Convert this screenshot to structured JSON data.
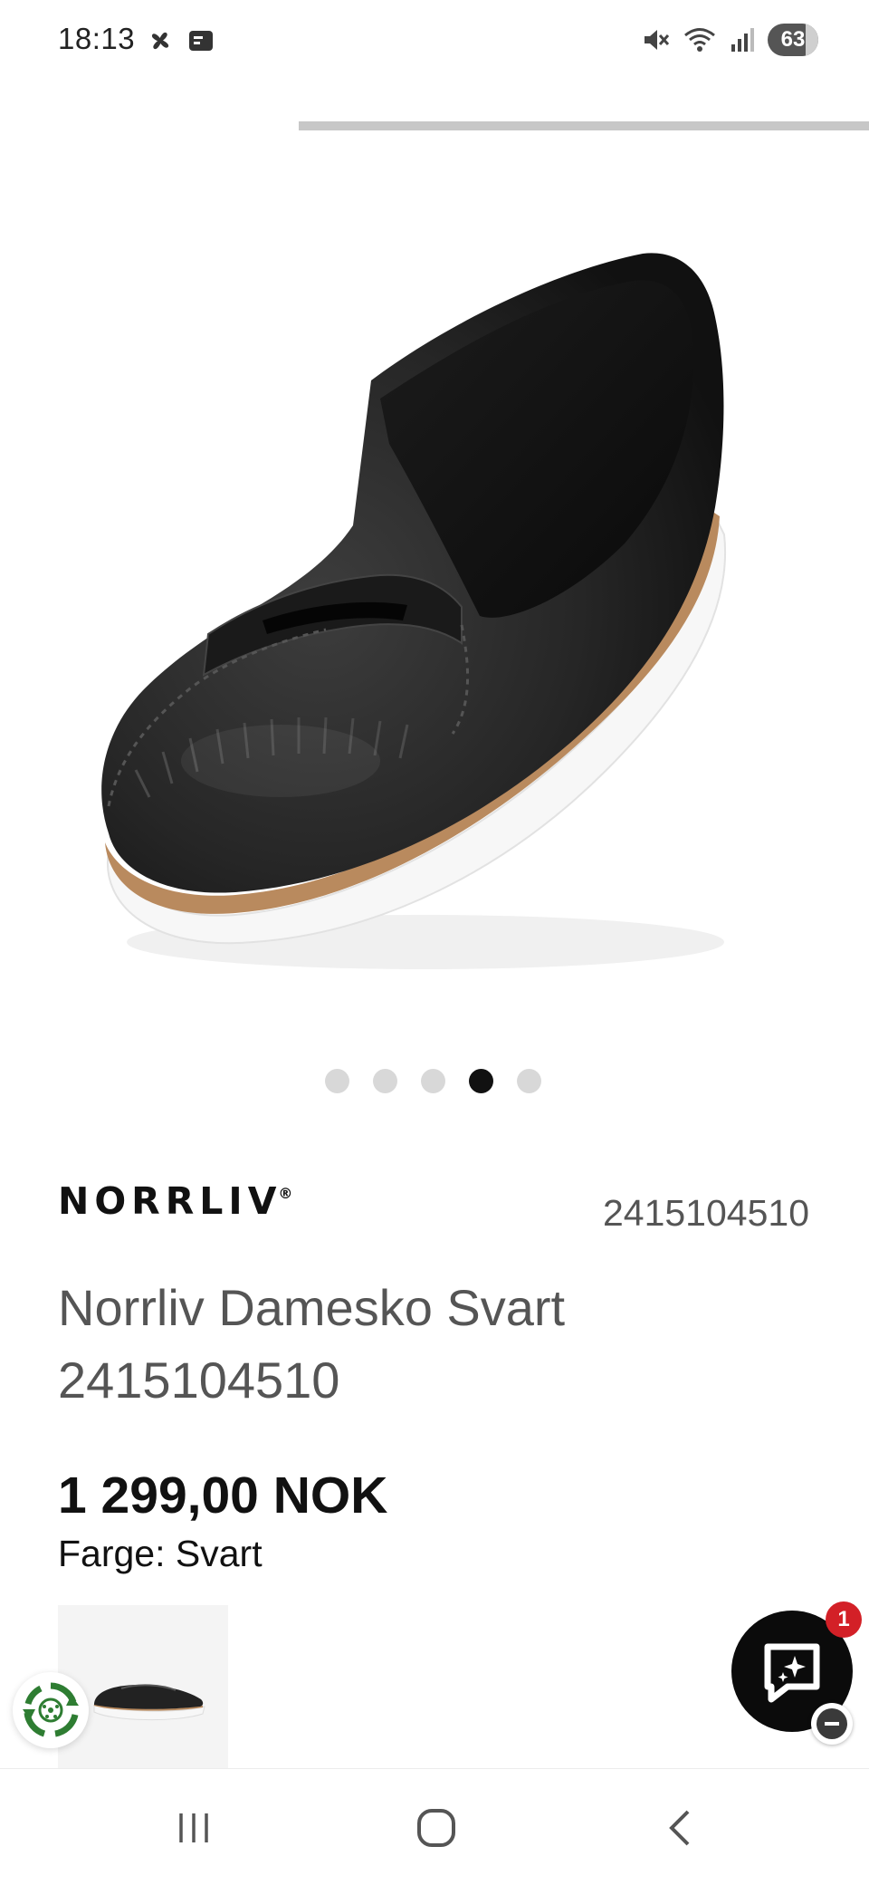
{
  "status_bar": {
    "time": "18:13",
    "battery": "63",
    "icons": [
      "pinwheel-icon",
      "notification-card-icon",
      "mute-icon",
      "wifi-icon",
      "signal-icon"
    ]
  },
  "product": {
    "brand": "NORRLIV",
    "brand_mark": "®",
    "sku": "2415104510",
    "title": "Norrliv Damesko Svart 2415104510",
    "price": "1 299,00 NOK",
    "color_label": "Farge: Svart",
    "image_count": 5,
    "active_image_index": 4
  },
  "chat": {
    "unread_count": "1"
  },
  "colors": {
    "accent_black": "#111111",
    "badge_red": "#d32027",
    "eco_green": "#2e7d32",
    "muted_text": "#555555"
  }
}
